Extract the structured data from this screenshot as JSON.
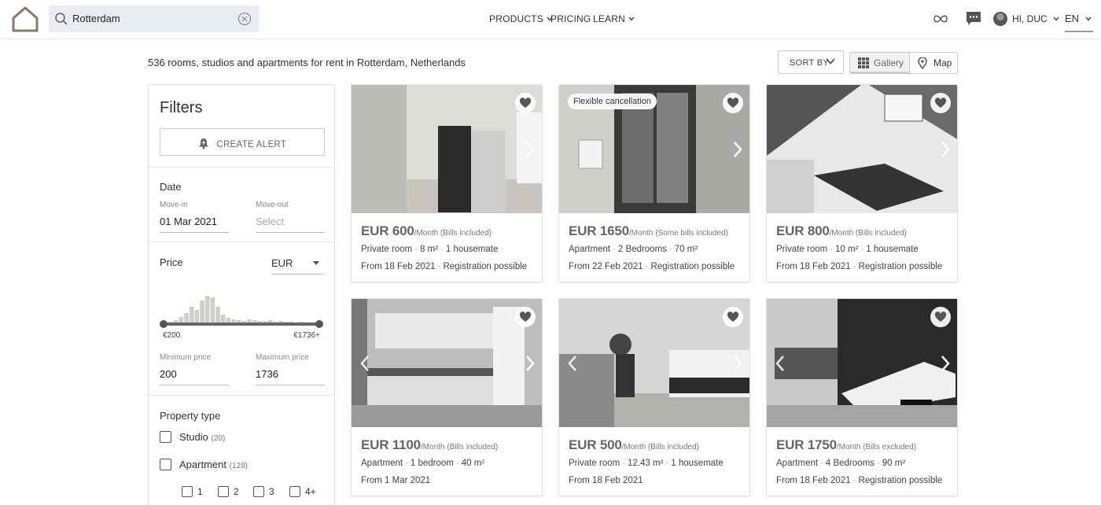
{
  "search": {
    "query": "Rotterdam"
  },
  "nav": [
    {
      "label": "PRODUCTS",
      "has_menu": true
    },
    {
      "label": "PRICING",
      "has_menu": false
    },
    {
      "label": "LEARN",
      "has_menu": true
    }
  ],
  "user": {
    "greeting": "HI, DUC",
    "language": "EN"
  },
  "results": {
    "count_text": "536 rooms, studios and apartments for rent in Rotterdam, Netherlands",
    "sort_label": "SORT BY",
    "view_gallery": "Gallery",
    "view_map": "Map",
    "active_view": "Gallery"
  },
  "filters": {
    "title": "Filters",
    "create_alert": "CREATE ALERT",
    "date": {
      "heading": "Date",
      "move_in_label": "Move-in",
      "move_in_value": "01 Mar 2021",
      "move_out_label": "Move-out",
      "move_out_placeholder": "Select"
    },
    "price": {
      "heading": "Price",
      "currency": "EUR",
      "range_min_label": "€200",
      "range_max_label": "€1736+",
      "min_label": "Minimum price",
      "min_value": "200",
      "max_label": "Maximum price",
      "max_value": "1736"
    },
    "property_type": {
      "heading": "Property type",
      "options": [
        {
          "label": "Studio",
          "count": "(20)",
          "checked": false
        },
        {
          "label": "Apartment",
          "count": "(128)",
          "checked": false
        }
      ],
      "bedrooms": [
        "1",
        "2",
        "3",
        "4+"
      ]
    }
  },
  "listings": [
    {
      "price": "EUR 600",
      "period": "/Month (Bills included)",
      "meta": [
        "Private room",
        "8 m²",
        "1 housemate"
      ],
      "avail": [
        "From 18 Feb 2021",
        "Registration possible"
      ],
      "badge": ""
    },
    {
      "price": "EUR 1650",
      "period": "/Month (Some bills included)",
      "meta": [
        "Apartment",
        "2 Bedrooms",
        "70 m²"
      ],
      "avail": [
        "From 22 Feb 2021",
        "Registration possible"
      ],
      "badge": "Flexible cancellation"
    },
    {
      "price": "EUR 800",
      "period": "/Month (Bills included)",
      "meta": [
        "Private room",
        "10 m²",
        "1 housemate"
      ],
      "avail": [
        "From 18 Feb 2021",
        "Registration possible"
      ],
      "badge": ""
    },
    {
      "price": "EUR 1100",
      "period": "/Month (Bills included)",
      "meta": [
        "Apartment",
        "1 bedroom",
        "40 m²"
      ],
      "avail": [
        "From 1 Mar 2021"
      ],
      "badge": ""
    },
    {
      "price": "EUR 500",
      "period": "/Month (Bills included)",
      "meta": [
        "Private room",
        "12.43 m²",
        "1 housemate"
      ],
      "avail": [
        "From 18 Feb 2021"
      ],
      "badge": ""
    },
    {
      "price": "EUR 1750",
      "period": "/Month (Bills excluded)",
      "meta": [
        "Apartment",
        "4 Bedrooms",
        "90 m²"
      ],
      "avail": [
        "From 18 Feb 2021",
        "Registration possible"
      ],
      "badge": ""
    }
  ],
  "icons": {
    "logo": "house-logo-icon",
    "search": "search-icon",
    "clear": "clear-circle-icon",
    "infinity": "infinity-icon",
    "chat": "chat-icon",
    "favorite": "heart-icon",
    "alert": "bell-icon",
    "gallery": "grid-icon",
    "map": "map-pin-icon"
  },
  "colors": {
    "brand": "#8a7a6a",
    "text": "#333333",
    "border": "#e0e0e0"
  }
}
